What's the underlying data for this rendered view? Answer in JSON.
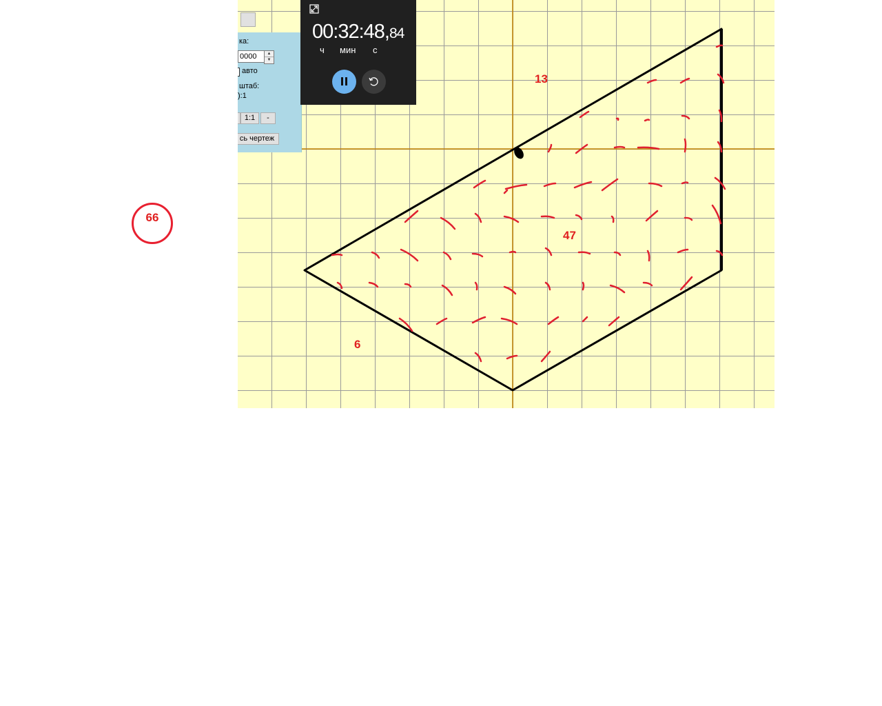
{
  "panel": {
    "step_label": "ка:",
    "step_value": "0000",
    "auto_label": "авто",
    "scale_label": "штаб:",
    "scale_value": "):1",
    "zoom_buttons": [
      "",
      "1:1",
      "-"
    ],
    "whole_drawing_label": "сь чертеж"
  },
  "stopwatch": {
    "time_main": "00:32:48,",
    "time_fraction": "84",
    "units": [
      "ч",
      "мин",
      "с"
    ]
  },
  "annotations": {
    "circled_number": "66",
    "label_top": "13",
    "label_center": "47",
    "label_bottom": "6"
  },
  "colors": {
    "canvas_background": "#ffffc8",
    "grid": "#9a9a9a",
    "axes": "#c08000",
    "outline": "#000000",
    "annotation": "#e02020",
    "panel": "#add8e6",
    "stopwatch_bg": "#202020",
    "pause_button": "#6cb2ee"
  }
}
